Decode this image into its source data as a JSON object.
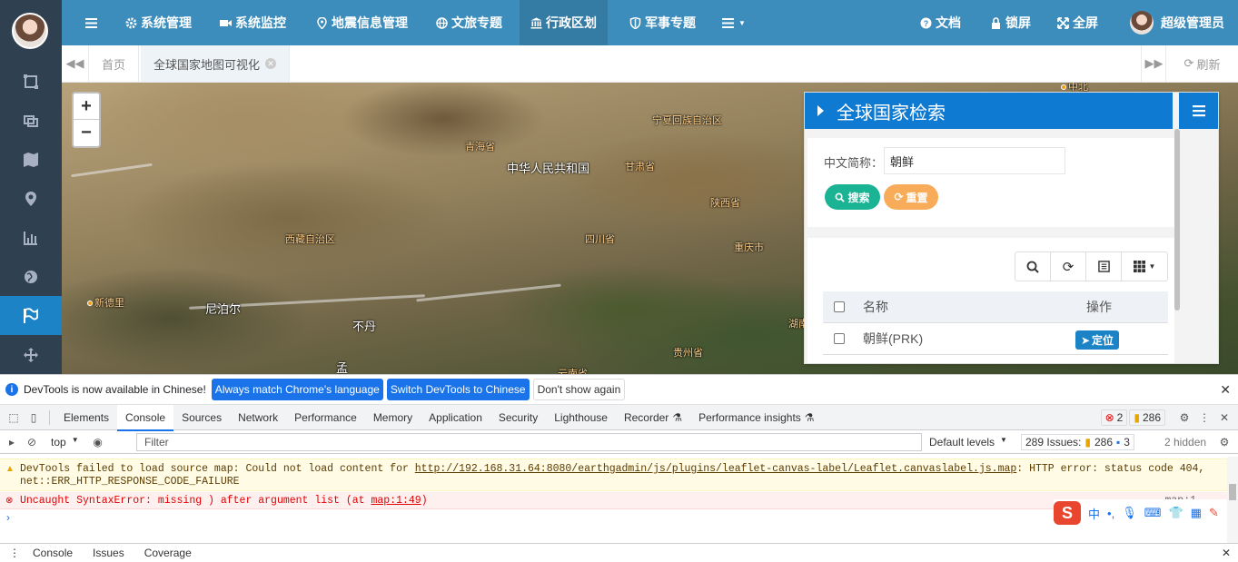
{
  "colors": {
    "header": "#3c8dbc",
    "sidebar": "#2f4050",
    "accent": "#1c84c6",
    "search": "#1ab394",
    "reset": "#f8ac59"
  },
  "sidebar": {
    "items": [
      {
        "icon": "frame-icon"
      },
      {
        "icon": "layers-icon"
      },
      {
        "icon": "map-icon"
      },
      {
        "icon": "map-marker-icon"
      },
      {
        "icon": "bar-chart-icon"
      },
      {
        "icon": "globe-icon"
      },
      {
        "icon": "flag-icon",
        "active": true
      },
      {
        "icon": "move-icon"
      }
    ]
  },
  "topnav": {
    "menu": [
      {
        "label": "系统管理",
        "icon": "gear-icon"
      },
      {
        "label": "系统监控",
        "icon": "video-icon"
      },
      {
        "label": "地震信息管理",
        "icon": "map-marker-icon"
      },
      {
        "label": "文旅专题",
        "icon": "globe-icon"
      },
      {
        "label": "行政区划",
        "icon": "bank-icon",
        "active": true
      },
      {
        "label": "军事专题",
        "icon": "shield-icon"
      }
    ],
    "right": {
      "docs": "文档",
      "lock": "锁屏",
      "fullscreen": "全屏",
      "user": "超级管理员"
    }
  },
  "tabs": {
    "home": "首页",
    "current": "全球国家地图可视化",
    "refresh": "刷新"
  },
  "map": {
    "labels": {
      "ningxia": "宁夏回族自治区",
      "qinghai": "青海省",
      "prc": "中华人民共和国",
      "gansu": "甘肃省",
      "shaanxi": "陕西省",
      "tibet": "西藏自治区",
      "sichuan": "四川省",
      "chongqing": "重庆市",
      "xindeli": "新德里",
      "nepal": "尼泊尔",
      "bhutan": "不丹",
      "guizhou": "贵州省",
      "meng": "孟",
      "hunan": "湖南",
      "yunnan": "云南省",
      "top_city": "中北"
    },
    "zoom_in": "+",
    "zoom_out": "−"
  },
  "panel": {
    "title": "全球国家检索",
    "form": {
      "label": "中文简称：",
      "value": "朝鲜",
      "search": "搜索",
      "reset": "重置"
    },
    "table": {
      "col_name": "名称",
      "col_action": "操作",
      "rows": [
        {
          "name": "朝鲜(PRK)",
          "action": "定位"
        }
      ]
    }
  },
  "devtools": {
    "info": {
      "text": "DevTools is now available in Chinese!",
      "btn1": "Always match Chrome's language",
      "btn2": "Switch DevTools to Chinese",
      "btn3": "Don't show again"
    },
    "tabs": [
      "Elements",
      "Console",
      "Sources",
      "Network",
      "Performance",
      "Memory",
      "Application",
      "Security",
      "Lighthouse",
      "Recorder",
      "Performance insights"
    ],
    "active_tab": "Console",
    "errors": "2",
    "warnings": "286",
    "filter": {
      "context": "top",
      "placeholder": "Filter",
      "levels": "Default levels",
      "issues_label": "289 Issues:",
      "issues_warn": "286",
      "issues_info": "3",
      "hidden": "2 hidden"
    },
    "messages": {
      "warn_pre": "DevTools failed to load source map: Could not load content for ",
      "warn_link": "http://192.168.31.64:8080/earthgadmin/js/plugins/leaflet-canvas-label/Leaflet.canvaslabel.js.map",
      "warn_post": ": HTTP error: status code 404,",
      "warn_line2": "net::ERR_HTTP_RESPONSE_CODE_FAILURE",
      "err_pre": "Uncaught SyntaxError: missing ) after argument list (at ",
      "err_link": "map:1:49",
      "err_post": ")",
      "err_src": "map:1"
    },
    "ime": {
      "lang": "中",
      "punct": "•,"
    },
    "drawer": [
      "Console",
      "Issues",
      "Coverage"
    ]
  }
}
